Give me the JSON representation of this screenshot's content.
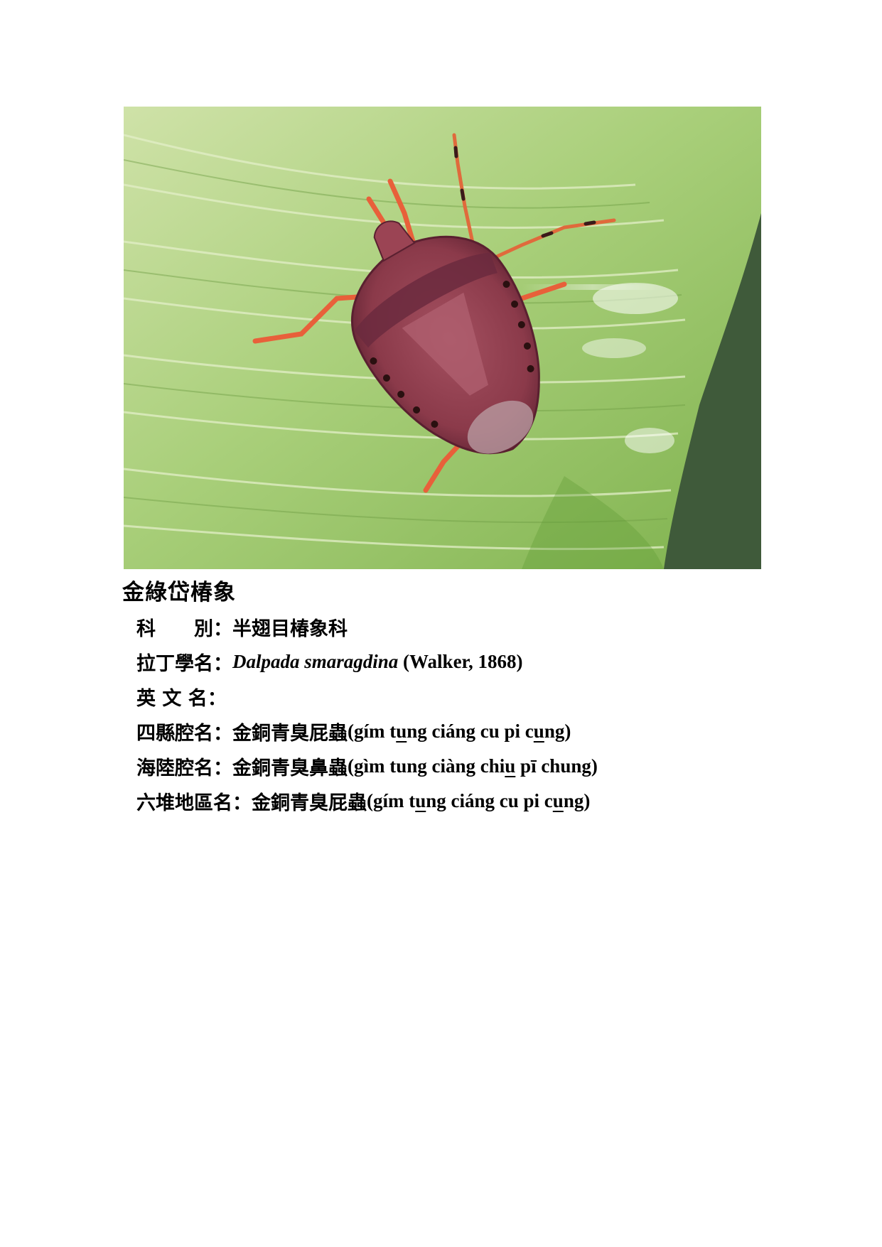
{
  "photo": {
    "subject": "stink-bug-on-green-leaf",
    "colors": {
      "leaf_light": "#cfe2a8",
      "leaf_mid": "#8dbd58",
      "leaf_dark": "#4e8a2a",
      "bug_body": "#8b3a4a",
      "bug_dark": "#5a2030",
      "legs": "#e8603a",
      "background_dark": "#3f5a3a"
    }
  },
  "title": "金綠岱椿象",
  "fields": {
    "family": {
      "label": "科　　別：",
      "value": "半翅目椿象科"
    },
    "latin": {
      "label": "拉丁學名：",
      "genus_species": "Dalpada smaragdina",
      "author": " (Walker, 1868)"
    },
    "english": {
      "label": "英 文 名："
    },
    "sixian": {
      "label": "四縣腔名：",
      "hanzi": "金銅青臭屁蟲",
      "rom_1": "(gím t",
      "rom_u1": "u",
      "rom_2": "ng ciáng cu pi c",
      "rom_u2": "u",
      "rom_3": "ng)"
    },
    "hailu": {
      "label": "海陸腔名：",
      "hanzi": "金銅青臭鼻蟲",
      "rom_1": "(gìm tung ciàng chi",
      "rom_u1": "u",
      "rom_2": " pī chung)"
    },
    "liudui": {
      "label": "六堆地區名：",
      "hanzi": "金銅青臭屁蟲",
      "rom_1": "(gím t",
      "rom_u1": "u",
      "rom_2": "ng ciáng cu pi c",
      "rom_u2": "u",
      "rom_3": "ng)"
    }
  }
}
